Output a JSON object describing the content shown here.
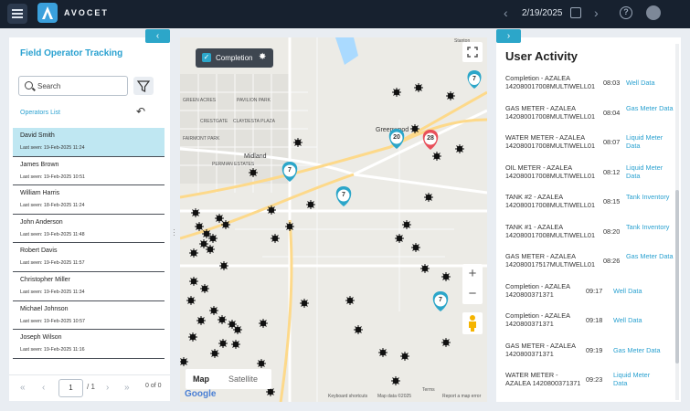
{
  "app": {
    "name": "AVOCET",
    "date": "2/19/2025"
  },
  "left_panel": {
    "title": "Field Operator Tracking",
    "search_placeholder": "Search",
    "subtitle": "Operators List",
    "operators": [
      {
        "name": "David Smith",
        "last_seen": "Last seen: 19-Feb-2025 11:24",
        "selected": true
      },
      {
        "name": "James Brown",
        "last_seen": "Last seen: 19-Feb-2025 10:51"
      },
      {
        "name": "William Harris",
        "last_seen": "Last seen: 18-Feb-2025 11:24"
      },
      {
        "name": "John Anderson",
        "last_seen": "Last seen: 19-Feb-2025 11:48"
      },
      {
        "name": "Robert Davis",
        "last_seen": "Last seen: 19-Feb-2025 11:57"
      },
      {
        "name": "Christopher Miller",
        "last_seen": "Last seen: 19-Feb-2025 11:34"
      },
      {
        "name": "Michael Johnson",
        "last_seen": "Last seen: 19-Feb-2025 10:57"
      },
      {
        "name": "Joseph Wilson",
        "last_seen": "Last seen: 19-Feb-2025 11:16"
      }
    ],
    "pager": {
      "page": "1",
      "total": "/ 1",
      "count": "0 of 0"
    }
  },
  "map": {
    "filter_label": "Completion",
    "map_type": "Map",
    "satellite_type": "Satellite",
    "google": "Google",
    "terms": "Terms",
    "shortcuts": "Keyboard shortcuts",
    "map_data": "Map data ©2025",
    "report": "Report a map error",
    "clusters": [
      "7",
      "20",
      "28",
      "7",
      "7",
      "7"
    ],
    "labels": [
      "GREEN ACRES",
      "PAVILION PARK",
      "CRESTGATE",
      "CLAYDESTA PLAZA",
      "FAIRMONT PARK",
      "Midland",
      "PERMIAN ESTATES",
      "Greenwood",
      "Stanton"
    ]
  },
  "right_panel": {
    "title": "User Activity",
    "activities": [
      {
        "desc": "Completion - AZALEA 142080017008MULTIWELL01",
        "time": "08:03",
        "type": "Well Data"
      },
      {
        "desc": "GAS METER - AZALEA 142080017008MULTIWELL01",
        "time": "08:04",
        "type": "Gas Meter Data"
      },
      {
        "desc": "WATER METER - AZALEA 142080017008MULTIWELL01",
        "time": "08:07",
        "type": "Liquid Meter Data"
      },
      {
        "desc": "OIL METER - AZALEA 142080017008MULTIWELL01",
        "time": "08:12",
        "type": "Liquid Meter Data"
      },
      {
        "desc": "TANK #2 - AZALEA 142080017008MULTIWELL01",
        "time": "08:15",
        "type": "Tank Inventory"
      },
      {
        "desc": "TANK #1 - AZALEA 142080017008MULTIWELL01",
        "time": "08:20",
        "type": "Tank Inventory"
      },
      {
        "desc": "GAS METER - AZALEA 142080017517MULTIWELL01",
        "time": "08:26",
        "type": "Gas Meter Data"
      },
      {
        "desc": "Completion - AZALEA 1420800371371",
        "time": "09:17",
        "type": "Well Data"
      },
      {
        "desc": "Completion - AZALEA 1420800371371",
        "time": "09:18",
        "type": "Well Data"
      },
      {
        "desc": "GAS METER - AZALEA 1420800371371",
        "time": "09:19",
        "type": "Gas Meter Data"
      },
      {
        "desc": "WATER METER - AZALEA 1420800371371",
        "time": "09:23",
        "type": "Liquid Meter Data"
      }
    ]
  }
}
